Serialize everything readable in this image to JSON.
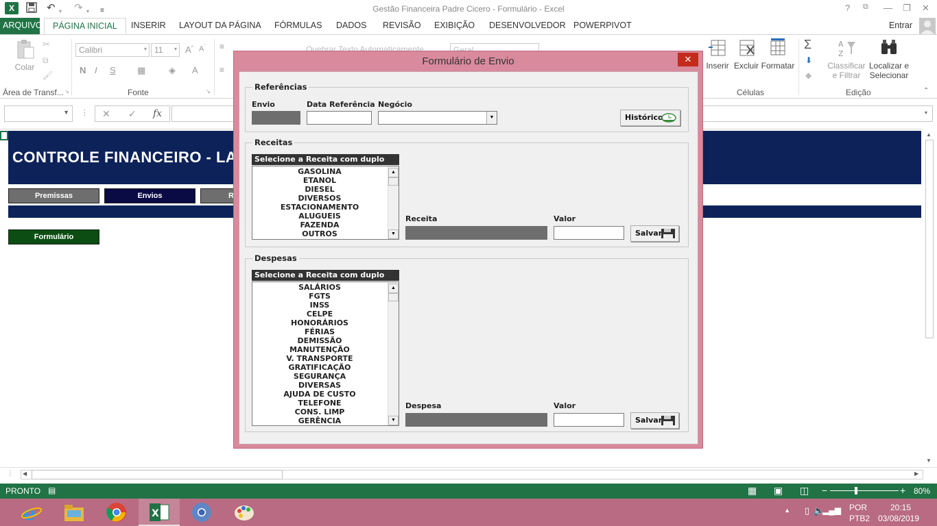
{
  "window": {
    "title": "Gestão Financeira Padre Cicero - Formulário - Excel",
    "help": "?",
    "minimize": "—",
    "restore": "❐",
    "close": "✕"
  },
  "ribbon_tabs": [
    {
      "label": "ARQUIVO"
    },
    {
      "label": "PÁGINA INICIAL"
    },
    {
      "label": "INSERIR"
    },
    {
      "label": "LAYOUT DA PÁGINA"
    },
    {
      "label": "FÓRMULAS"
    },
    {
      "label": "DADOS"
    },
    {
      "label": "REVISÃO"
    },
    {
      "label": "EXIBIÇÃO"
    },
    {
      "label": "DESENVOLVEDOR"
    },
    {
      "label": "POWERPIVOT"
    }
  ],
  "user_label": "Entrar",
  "ribbon": {
    "paste_label": "Colar",
    "clipboard_group": "Área de Transf...",
    "font_name": "Calibri",
    "font_size": "11",
    "font_group": "Fonte",
    "bold": "N",
    "italic": "I",
    "underline": "S",
    "wrap_text": "Quebrar Texto Automaticamente",
    "number_format": "Geral",
    "insert_label": "Inserir",
    "delete_label": "Excluir",
    "format_label": "Formatar",
    "cells_group": "Células",
    "sort_label_1": "Classificar",
    "sort_label_2": "e Filtrar",
    "find_label_1": "Localizar e",
    "find_label_2": "Selecionar",
    "editing_group": "Edição"
  },
  "formula_bar": {
    "fx": "fx",
    "cancel": "✕",
    "confirm": "✓"
  },
  "sheet": {
    "banner_title": "CONTROLE FINANCEIRO - LAN",
    "nav_buttons": [
      {
        "label": "Premissas"
      },
      {
        "label": "Envios"
      },
      {
        "label": "R"
      }
    ],
    "form_button": "Formulário"
  },
  "dialog": {
    "title": "Formulário de Envio",
    "close": "✕",
    "referencias": {
      "frame_title": "Referências",
      "envio_label": "Envio",
      "data_label": "Data Referência",
      "negocio_label": "Negócio",
      "historico_button": "Histórico"
    },
    "receitas": {
      "frame_title": "Receitas",
      "list_header": "Selecione a Receita com duplo clique",
      "items": [
        "GASOLINA",
        "ETANOL",
        "DIESEL",
        "DIVERSOS",
        "ESTACIONAMENTO",
        "ALUGUEIS",
        "FAZENDA",
        "OUTROS"
      ],
      "receita_label": "Receita",
      "valor_label": "Valor",
      "save_button": "Salvar"
    },
    "despesas": {
      "frame_title": "Despesas",
      "list_header": "Selecione a Receita com duplo clique",
      "items": [
        "SALÁRIOS",
        "FGTS",
        "INSS",
        "CELPE",
        "HONORÁRIOS",
        "FÉRIAS",
        "DEMISSÃO",
        "MANUTENÇÃO",
        "V. TRANSPORTE",
        "GRATIFICAÇÃO",
        "SEGURANÇA",
        "DIVERSAS",
        "AJUDA DE CUSTO",
        "TELEFONE",
        "CONS. LIMP",
        "GERÊNCIA"
      ],
      "despesa_label": "Despesa",
      "valor_label": "Valor",
      "save_button": "Salvar"
    }
  },
  "status_bar": {
    "ready": "PRONTO",
    "zoom": "80%",
    "zoom_minus": "−",
    "zoom_plus": "+"
  },
  "taskbar": {
    "lang": "POR",
    "kb": "PTB2",
    "time": "20:15",
    "date": "03/08/2019"
  },
  "colors": {
    "excel_green": "#217346",
    "banner_navy": "#0d2259",
    "dialog_border": "#d98a9c",
    "form_button_green": "#0b4d12",
    "envios_button": "#0a0a45",
    "nav_button_gray": "#6e6e6e"
  }
}
